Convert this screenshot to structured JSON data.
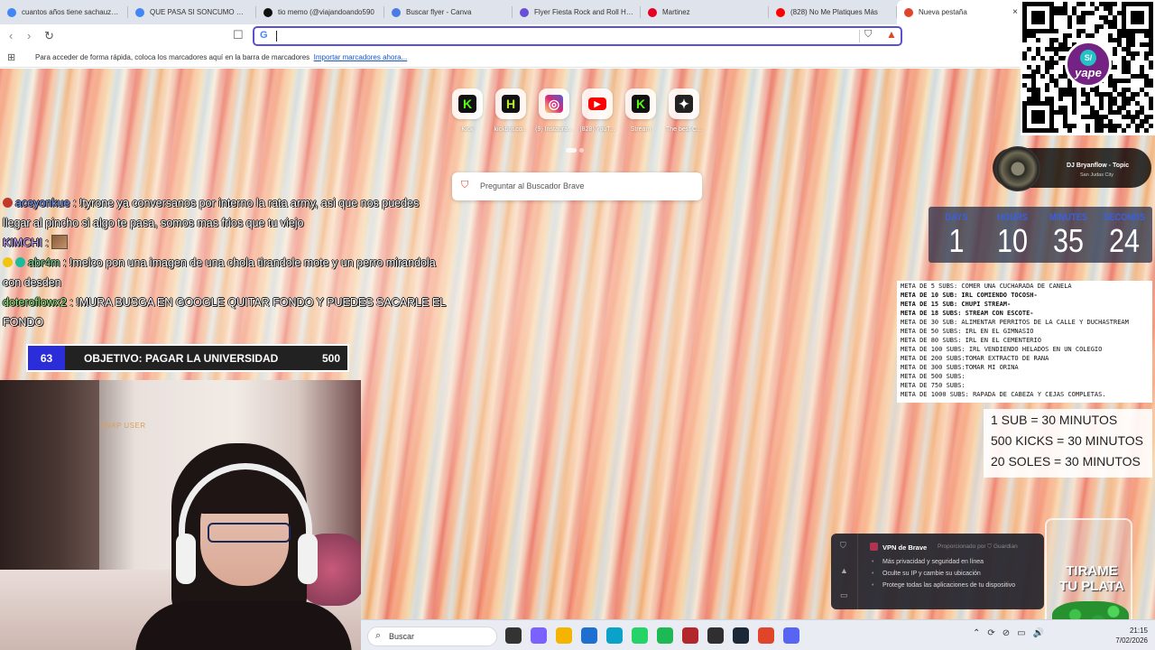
{
  "browser": {
    "tabs": [
      {
        "title": "cuantos años tiene sachauzum",
        "icon": "google-icon",
        "color": "#4285f4"
      },
      {
        "title": "QUE PASA SI SONCUMO MUC",
        "icon": "google-icon",
        "color": "#4285f4"
      },
      {
        "title": "tio memo (@viajandoando590",
        "icon": "tiktok-icon",
        "color": "#111111"
      },
      {
        "title": "Buscar flyer - Canva",
        "icon": "canva-icon",
        "color": "#4b7be5"
      },
      {
        "title": "Flyer Fiesta Rock and Roll Hea",
        "icon": "canva-icon",
        "color": "#6a4fd6"
      },
      {
        "title": "Martinez",
        "icon": "pinterest-icon",
        "color": "#e60023"
      },
      {
        "title": "(828) No Me Platiques Más",
        "icon": "youtube-icon",
        "color": "#ff0000"
      },
      {
        "title": "Nueva pestaña",
        "icon": "brave-icon",
        "color": "#e0452c",
        "active": true
      }
    ],
    "tab_close": "×",
    "nav": {
      "back": "‹",
      "forward": "›",
      "reload": "↻"
    },
    "omnibox": {
      "value": "",
      "placeholder": "",
      "engine_glyph": "G"
    },
    "bookmarks_bar": {
      "message": "Para acceder de forma rápida, coloca los marcadores aquí en la barra de marcadores",
      "link": "Importar marcadores ahora..."
    }
  },
  "new_tab": {
    "top_sites": [
      {
        "label": "Kick",
        "icon": "kick-icon",
        "glyph": "K",
        "color": "#53fc18"
      },
      {
        "label": "kickbot.co...",
        "icon": "kickbot-icon",
        "glyph": "H",
        "color": "#b7f02e"
      },
      {
        "label": "(9) Instagra...",
        "icon": "instagram-icon",
        "glyph": "◎",
        "color": "#d62976"
      },
      {
        "label": "(828) YouT...",
        "icon": "youtube-icon",
        "glyph": "▶",
        "color": "#ff0000"
      },
      {
        "label": "Stream",
        "icon": "kick-icon",
        "glyph": "K",
        "color": "#53fc18"
      },
      {
        "label": "The best C...",
        "icon": "game-icon",
        "glyph": "✦",
        "color": "#222222"
      }
    ],
    "search_placeholder": "Preguntar al Buscador Brave"
  },
  "chat": [
    {
      "user": "aceyonkue",
      "text": " : !tyrone ya conversanos por interno la rata army, asi que nos puedes llegar al pincho si algo te pasa, somos mas frios que tu viejo"
    },
    {
      "user": "KIMCHI",
      "text": " : "
    },
    {
      "user": "abr4m",
      "text": " : !melco pon una imagen de una chola tirandole mote y un perro mirandola con desden"
    },
    {
      "user": "doteroflowx2",
      "text": " : !MURA BUSGA EN GOOGLE QUITAR FONDO Y PUEDES SACARLE EL FONDO"
    }
  ],
  "goal": {
    "current": "63",
    "label": "OBJETIVO: PAGAR LA UNIVERSIDAD",
    "target": "500"
  },
  "webcam": {
    "label": "SNAP USER"
  },
  "now_playing": {
    "title": "DJ Bryanflow - Topic",
    "subtitle": "San Judas City"
  },
  "countdown": [
    {
      "label": "DAYS",
      "value": "1"
    },
    {
      "label": "HOURS",
      "value": "10"
    },
    {
      "label": "MINUTES",
      "value": "35"
    },
    {
      "label": "SECONDS",
      "value": "24"
    }
  ],
  "metas": [
    {
      "text": "META DE 5 SUBS: COMER UNA CUCHARADA DE CANELA",
      "bold": false
    },
    {
      "text": "META DE 10 SUB: IRL COMIENDO TOCOSH-",
      "bold": true
    },
    {
      "text": "META DE 15 SUB: CHUPI STREAM-",
      "bold": true
    },
    {
      "text": "META DE 18 SUBS: STREAM CON ESCOTE-",
      "bold": true
    },
    {
      "text": "META DE 30 SUB:  ALIMENTAR PERRITOS DE LA CALLE Y DUCHASTREAM",
      "bold": false
    },
    {
      "text": "META DE 50 SUBS: IRL EN EL GIMNASIO",
      "bold": false
    },
    {
      "text": "META DE 80 SUBS: IRL EN EL CEMENTERIO",
      "bold": false
    },
    {
      "text": "META DE 100 SUBS: IRL VENDIENDO HELADOS EN UN COLEGIO",
      "bold": false
    },
    {
      "text": "META DE 200 SUBS:TOMAR EXTRACTO DE RANA",
      "bold": false
    },
    {
      "text": "META DE 300 SUBS:TOMAR MI ORINA",
      "bold": false
    },
    {
      "text": "META DE 500 SUBS:",
      "bold": false
    },
    {
      "text": "META DE 750 SUBS:",
      "bold": false
    },
    {
      "text": "META DE 1000 SUBS: RAPADA DE CABEZA Y CEJAS COMPLETAS.",
      "bold": false
    }
  ],
  "rates": [
    "1 SUB = 30 MINUTOS",
    "500 KICKS = 30 MINUTOS",
    "20 SOLES = 30 MINUTOS"
  ],
  "qr": {
    "badge_top": "S/",
    "badge_word": "yape"
  },
  "vpn": {
    "title": "VPN de Brave",
    "provider": "Proporcionado por ⛉ Guardian",
    "items": [
      "Más privacidad y seguridad en línea",
      "Oculte su IP y cambie su ubicación",
      "Protege todas las aplicaciones de tu dispositivo"
    ]
  },
  "jar": {
    "text": "TIRAME TU PLATA"
  },
  "taskbar": {
    "search_label": "Buscar",
    "apps": [
      {
        "icon": "task-view-icon",
        "color": "#333333"
      },
      {
        "icon": "copilot-icon",
        "color": "#7b61ff"
      },
      {
        "icon": "file-explorer-icon",
        "color": "#f4b400"
      },
      {
        "icon": "store-icon",
        "color": "#1f6fd1"
      },
      {
        "icon": "edge-icon",
        "color": "#0aa2c8"
      },
      {
        "icon": "whatsapp-icon",
        "color": "#25d366"
      },
      {
        "icon": "spotify-icon",
        "color": "#1db954"
      },
      {
        "icon": "app-red-icon",
        "color": "#b3262c"
      },
      {
        "icon": "obs-icon",
        "color": "#302e31"
      },
      {
        "icon": "steam-icon",
        "color": "#1b2838"
      },
      {
        "icon": "brave-icon",
        "color": "#e0452c"
      },
      {
        "icon": "discord-icon",
        "color": "#5865f2"
      }
    ],
    "tray_glyphs": [
      "⌃",
      "⟳",
      "⊘",
      "▭",
      "🔊"
    ],
    "time": "21:15",
    "date": "7/02/2026"
  }
}
